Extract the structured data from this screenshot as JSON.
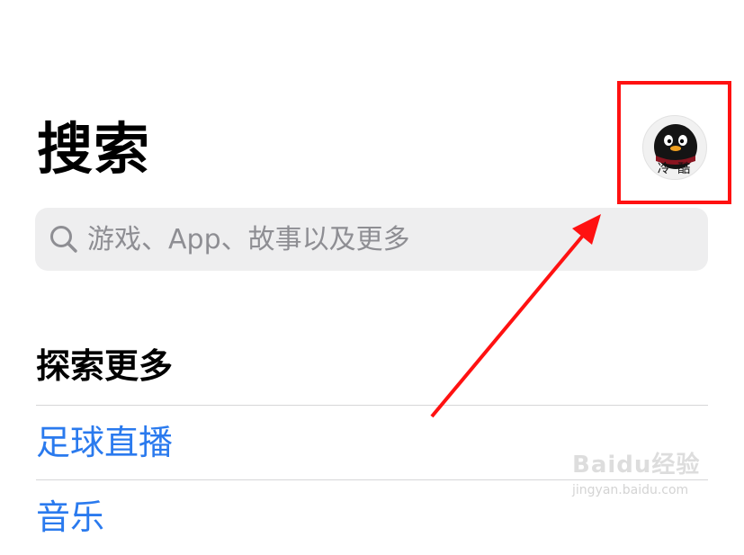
{
  "header": {
    "title": "搜索",
    "avatar": {
      "text": "冷 酷",
      "icon": "qq-penguin-avatar"
    }
  },
  "search": {
    "placeholder": "游戏、App、故事以及更多",
    "icon": "search-icon"
  },
  "explore": {
    "heading": "探索更多",
    "items": [
      {
        "label": "足球直播"
      },
      {
        "label": "音乐"
      }
    ]
  },
  "annotation": {
    "color": "#ff1111"
  },
  "colors": {
    "link": "#2a7aee",
    "search_bg": "#eeeeef",
    "placeholder": "#8e8e93"
  },
  "watermark": {
    "logo": "Baidu经验",
    "url": "jingyan.baidu.com"
  }
}
